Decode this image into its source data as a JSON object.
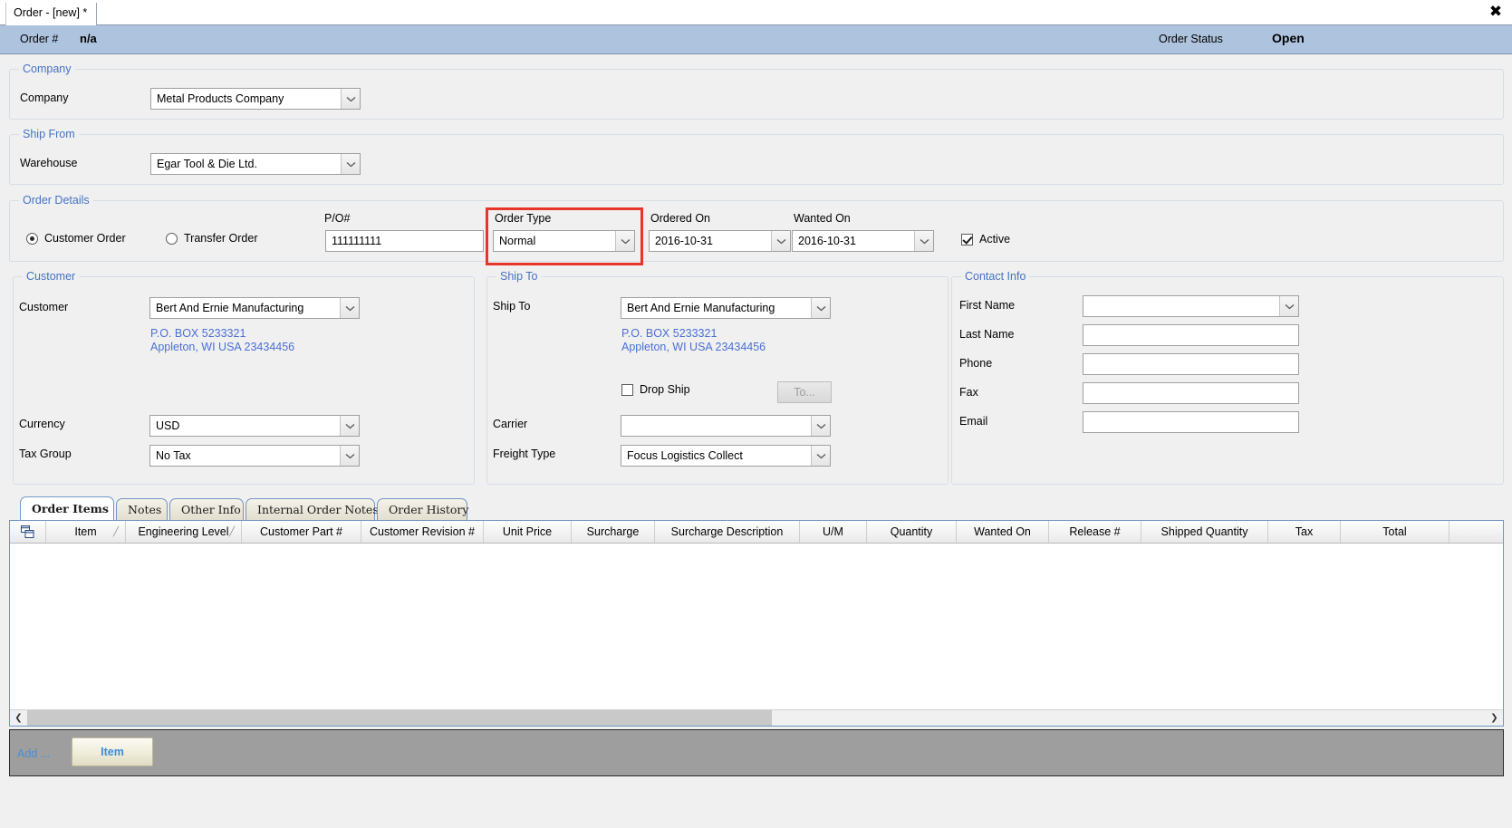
{
  "window": {
    "tab_title": "Order - [new] *",
    "close_icon": "close-icon"
  },
  "order_strip": {
    "order_number_label": "Order #",
    "order_number_value": "n/a",
    "status_label": "Order Status",
    "status_value": "Open",
    "background": "#aec3de"
  },
  "company_group": {
    "legend": "Company",
    "company_label": "Company",
    "company_value": "Metal Products Company"
  },
  "ship_from_group": {
    "legend": "Ship From",
    "warehouse_label": "Warehouse",
    "warehouse_value": "Egar Tool & Die Ltd."
  },
  "order_details_group": {
    "legend": "Order Details",
    "customer_order_label": "Customer Order",
    "customer_order_selected": true,
    "transfer_order_label": "Transfer Order",
    "transfer_order_selected": false,
    "po_label": "P/O#",
    "po_value": "111111111",
    "order_type_label": "Order Type",
    "order_type_value": "Normal",
    "ordered_on_label": "Ordered On",
    "ordered_on_value": "2016-10-31",
    "wanted_on_label": "Wanted On",
    "wanted_on_value": "2016-10-31",
    "active_label": "Active",
    "active_checked": true,
    "highlight_color": "#e8352a"
  },
  "customer_group": {
    "legend": "Customer",
    "customer_label": "Customer",
    "customer_value": "Bert And Ernie Manufacturing",
    "address_line1": "P.O. BOX 5233321",
    "address_line2": "Appleton, WI USA 23434456",
    "currency_label": "Currency",
    "currency_value": "USD",
    "tax_group_label": "Tax Group",
    "tax_group_value": "No Tax"
  },
  "ship_to_group": {
    "legend": "Ship To",
    "ship_to_label": "Ship To",
    "ship_to_value": "Bert And Ernie Manufacturing",
    "address_line1": "P.O. BOX 5233321",
    "address_line2": "Appleton, WI USA 23434456",
    "drop_ship_label": "Drop Ship",
    "drop_ship_checked": false,
    "to_button_label": "To...",
    "carrier_label": "Carrier",
    "carrier_value": "",
    "freight_type_label": "Freight Type",
    "freight_type_value": "Focus Logistics Collect"
  },
  "contact_info_group": {
    "legend": "Contact Info",
    "first_name_label": "First Name",
    "first_name_value": "",
    "last_name_label": "Last Name",
    "last_name_value": "",
    "phone_label": "Phone",
    "phone_value": "",
    "fax_label": "Fax",
    "fax_value": "",
    "email_label": "Email",
    "email_value": ""
  },
  "tabs": [
    {
      "label": "Order Items",
      "active": true
    },
    {
      "label": "Notes",
      "active": false
    },
    {
      "label": "Other Info",
      "active": false
    },
    {
      "label": "Internal Order Notes",
      "active": false
    },
    {
      "label": "Order History",
      "active": false
    }
  ],
  "grid": {
    "row_selector_icon": "grid-select-icon",
    "columns": [
      {
        "label": "Item",
        "sorted": true
      },
      {
        "label": "Engineering Level",
        "sorted": true
      },
      {
        "label": "Customer Part #",
        "sorted": false
      },
      {
        "label": "Customer Revision #",
        "sorted": false
      },
      {
        "label": "Unit Price",
        "sorted": false
      },
      {
        "label": "Surcharge",
        "sorted": false
      },
      {
        "label": "Surcharge Description",
        "sorted": false
      },
      {
        "label": "U/M",
        "sorted": false
      },
      {
        "label": "Quantity",
        "sorted": false
      },
      {
        "label": "Wanted On",
        "sorted": false
      },
      {
        "label": "Release #",
        "sorted": false
      },
      {
        "label": "Shipped Quantity",
        "sorted": false
      },
      {
        "label": "Tax",
        "sorted": false
      },
      {
        "label": "Total",
        "sorted": false
      }
    ],
    "rows": [],
    "scroll_left_icon": "chevron-left-icon",
    "scroll_right_icon": "chevron-right-icon"
  },
  "action_bar": {
    "add_label": "Add ...",
    "item_button_label": "Item"
  }
}
